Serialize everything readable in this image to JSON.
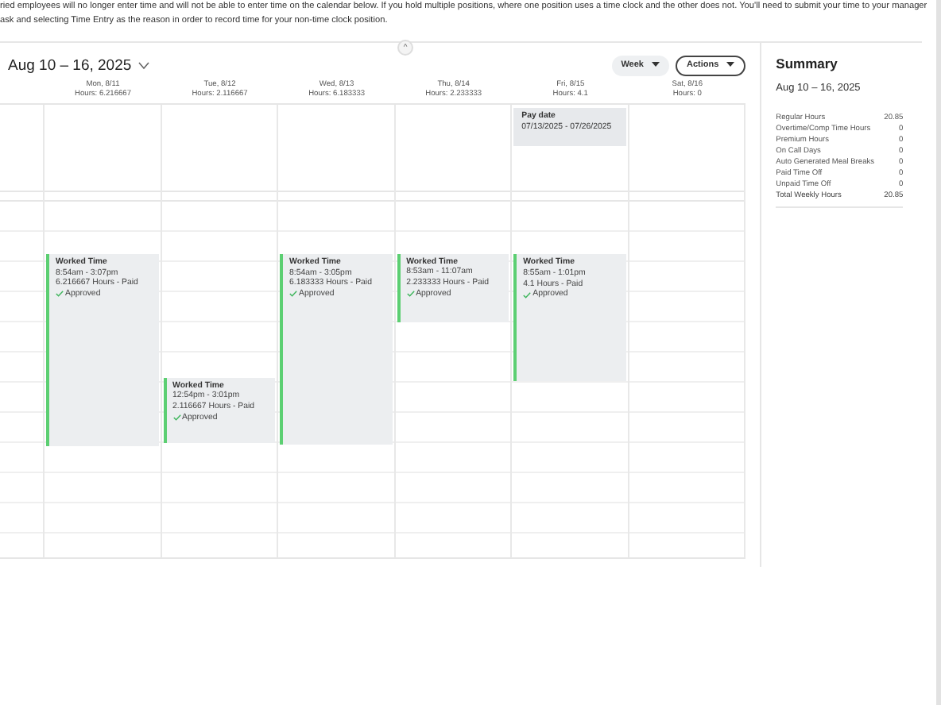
{
  "notice": {
    "lines": [
      "ried employees will no longer enter time and will not be able to enter time on the calendar below. If you hold multiple positions, where one position uses a time clock and the other does not. You'll need to submit your time to your manager",
      "ask and selecting Time Entry as the reason in order to record time for your non-time clock position."
    ]
  },
  "collapse": {
    "label": "^"
  },
  "toolbar": {
    "range": "Aug 10 – 16, 2025",
    "view": "Week",
    "actions": "Actions"
  },
  "days": [
    {
      "label": "Mon, 8/11",
      "hours": "Hours: 6.216667",
      "events": [
        {
          "title": "Worked Time",
          "time": "8:54am - 3:07pm",
          "detail": "6.216667 Hours - Paid",
          "status": "Approved",
          "approved": true
        }
      ]
    },
    {
      "label": "Tue, 8/12",
      "hours": "Hours: 2.116667",
      "events": [
        {
          "title": "Worked Time",
          "time": "12:54pm - 3:01pm",
          "detail": "2.116667 Hours - Paid",
          "status": "Approved",
          "approved": true
        }
      ]
    },
    {
      "label": "Wed, 8/13",
      "hours": "Hours: 6.183333",
      "events": [
        {
          "title": "Worked Time",
          "time": "8:54am - 3:05pm",
          "detail": "6.183333 Hours - Paid",
          "status": "Approved",
          "approved": true
        }
      ]
    },
    {
      "label": "Thu, 8/14",
      "hours": "Hours: 2.233333",
      "events": [
        {
          "title": "Worked Time",
          "time": "8:53am - 11:07am",
          "detail": "2.233333 Hours - Paid",
          "status": "Approved",
          "approved": true
        }
      ]
    },
    {
      "label": "Fri, 8/15",
      "hours": "Hours: 4.1",
      "all_day": {
        "title": "Pay date",
        "range": "07/13/2025 - 07/26/2025"
      },
      "events": [
        {
          "title": "Worked Time",
          "time": "8:55am - 1:01pm",
          "detail": "4.1 Hours - Paid",
          "status": "Approved",
          "approved": true
        }
      ]
    },
    {
      "label": "Sat, 8/16",
      "hours": "Hours: 0"
    }
  ],
  "summary": {
    "title": "Summary",
    "range": "Aug 10 – 16, 2025",
    "rows": [
      {
        "label": "Regular Hours",
        "value": "20.85",
        "total": false
      },
      {
        "label": "Overtime/Comp Time Hours",
        "value": "0",
        "total": false
      },
      {
        "label": "Premium Hours",
        "value": "0",
        "total": false
      },
      {
        "label": "On Call Days",
        "value": "0",
        "total": false
      },
      {
        "label": "Auto Generated Meal Breaks",
        "value": "0",
        "total": false
      },
      {
        "label": "Paid Time Off",
        "value": "0",
        "total": false
      },
      {
        "label": "Unpaid Time Off",
        "value": "0",
        "total": false
      },
      {
        "label": "Total Weekly Hours",
        "value": "20.85",
        "total": true
      }
    ]
  }
}
